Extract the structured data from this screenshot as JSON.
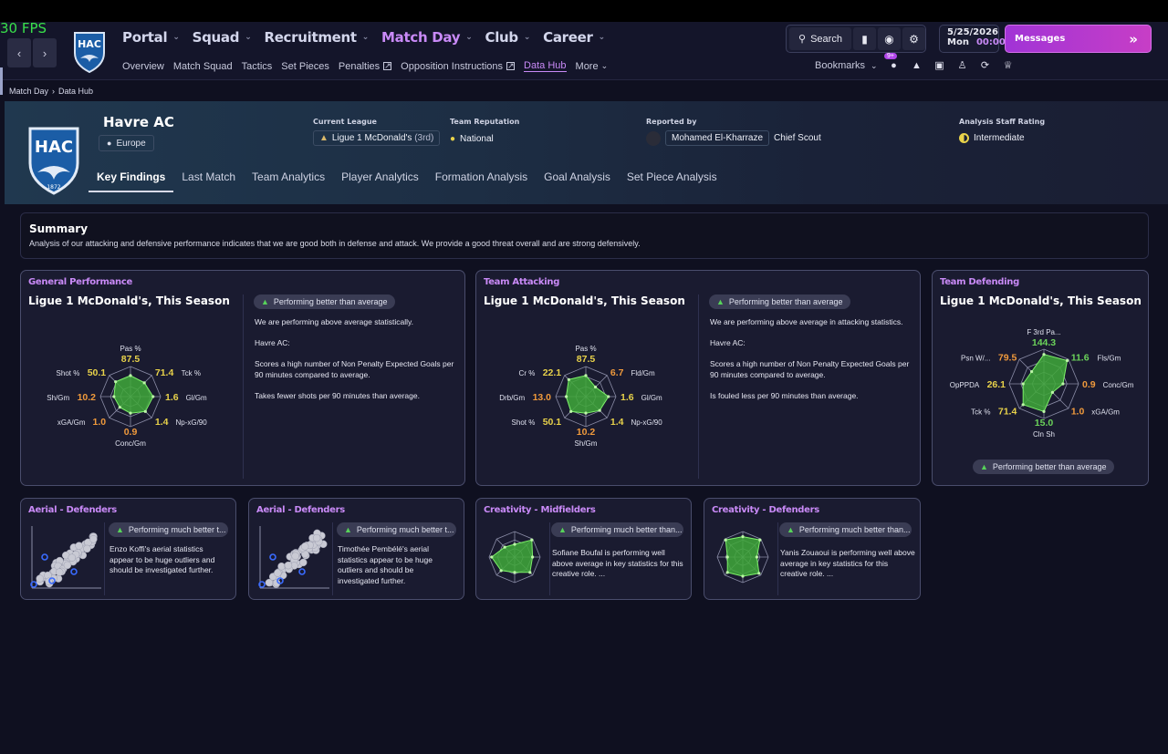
{
  "fps": "30 FPS",
  "nav": {
    "main": [
      {
        "label": "Portal",
        "active": false
      },
      {
        "label": "Squad",
        "active": false
      },
      {
        "label": "Recruitment",
        "active": false
      },
      {
        "label": "Match Day",
        "active": true
      },
      {
        "label": "Club",
        "active": false
      },
      {
        "label": "Career",
        "active": false
      }
    ],
    "sub": [
      {
        "label": "Overview",
        "active": false,
        "external": false
      },
      {
        "label": "Match Squad",
        "active": false,
        "external": false
      },
      {
        "label": "Tactics",
        "active": false,
        "external": false
      },
      {
        "label": "Set Pieces",
        "active": false,
        "external": false
      },
      {
        "label": "Penalties",
        "active": false,
        "external": true
      },
      {
        "label": "Opposition Instructions",
        "active": false,
        "external": true
      },
      {
        "label": "Data Hub",
        "active": true,
        "external": false
      },
      {
        "label": "More",
        "active": false,
        "external": false
      }
    ],
    "search_label": "Search",
    "date": "5/25/2026",
    "day": "Mon",
    "time": "00:00",
    "messages_label": "Messages",
    "bookmarks_label": "Bookmarks",
    "notif_badge": "9+"
  },
  "breadcrumb": [
    "Match Day",
    "Data Hub"
  ],
  "club": {
    "name": "Havre AC",
    "badge_text": "HAC",
    "badge_year": "1872",
    "region": "Europe",
    "current_league_label": "Current League",
    "current_league": "Ligue 1 McDonald's",
    "league_position": "(3rd)",
    "reputation_label": "Team Reputation",
    "reputation": "National",
    "reported_by_label": "Reported by",
    "reporter": "Mohamed El-Kharraze",
    "reporter_role": "Chief Scout",
    "rating_label": "Analysis Staff Rating",
    "rating": "Intermediate"
  },
  "tabs": [
    "Key Findings",
    "Last Match",
    "Team Analytics",
    "Player Analytics",
    "Formation Analysis",
    "Goal Analysis",
    "Set Piece Analysis"
  ],
  "summary": {
    "title": "Summary",
    "body": "Analysis of our attacking and defensive performance indicates that we are good both in defense and attack. We provide a good threat overall and are strong defensively."
  },
  "panels": [
    {
      "title": "General Performance",
      "subtitle": "Ligue 1 McDonald's, This Season",
      "pill": "Performing better than average",
      "text": [
        "We are performing above average statistically.",
        "Havre AC:",
        "Scores a high number of Non Penalty Expected Goals per 90 minutes compared to average.",
        "Takes fewer shots per 90 minutes than average."
      ],
      "radar": [
        {
          "label": "Pas %",
          "value": "87.5",
          "color": "#e8d24a"
        },
        {
          "label": "Tck %",
          "value": "71.4",
          "color": "#e8d24a"
        },
        {
          "label": "Gl/Gm",
          "value": "1.6",
          "color": "#e8d24a"
        },
        {
          "label": "Np-xG/90",
          "value": "1.4",
          "color": "#e8d24a"
        },
        {
          "label": "Conc/Gm",
          "value": "0.9",
          "color": "#f09a3c"
        },
        {
          "label": "xGA/Gm",
          "value": "1.0",
          "color": "#f09a3c"
        },
        {
          "label": "Sh/Gm",
          "value": "10.2",
          "color": "#f09a3c"
        },
        {
          "label": "Shot %",
          "value": "50.1",
          "color": "#e8d24a"
        }
      ]
    },
    {
      "title": "Team Attacking",
      "subtitle": "Ligue 1 McDonald's, This Season",
      "pill": "Performing better than average",
      "text": [
        "We are performing above average in attacking statistics.",
        "Havre AC:",
        "Scores a high number of Non Penalty Expected Goals per 90 minutes compared to average.",
        "Is fouled less per 90 minutes than average."
      ],
      "radar": [
        {
          "label": "Pas %",
          "value": "87.5",
          "color": "#e8d24a"
        },
        {
          "label": "Fld/Gm",
          "value": "6.7",
          "color": "#f09a3c"
        },
        {
          "label": "Gl/Gm",
          "value": "1.6",
          "color": "#e8d24a"
        },
        {
          "label": "Np-xG/90",
          "value": "1.4",
          "color": "#e8d24a"
        },
        {
          "label": "Sh/Gm",
          "value": "10.2",
          "color": "#f09a3c"
        },
        {
          "label": "Shot %",
          "value": "50.1",
          "color": "#e8d24a"
        },
        {
          "label": "Drb/Gm",
          "value": "13.0",
          "color": "#f09a3c"
        },
        {
          "label": "Cr %",
          "value": "22.1",
          "color": "#e8d24a"
        }
      ]
    },
    {
      "title": "Team Defending",
      "subtitle": "Ligue 1 McDonald's, This Season",
      "pill": "Performing better than average",
      "radar": [
        {
          "label": "F 3rd Pa...",
          "value": "144.3",
          "color": "#6bd35a"
        },
        {
          "label": "Fls/Gm",
          "value": "11.6",
          "color": "#6bd35a"
        },
        {
          "label": "Conc/Gm",
          "value": "0.9",
          "color": "#f09a3c"
        },
        {
          "label": "xGA/Gm",
          "value": "1.0",
          "color": "#f09a3c"
        },
        {
          "label": "Cln Sh",
          "value": "15.0",
          "color": "#6bd35a"
        },
        {
          "label": "Tck %",
          "value": "71.4",
          "color": "#e8d24a"
        },
        {
          "label": "OpPPDA",
          "value": "26.1",
          "color": "#e8d24a"
        },
        {
          "label": "Psn W/...",
          "value": "79.5",
          "color": "#f09a3c"
        }
      ]
    }
  ],
  "mini_panels": [
    {
      "title": "Aerial - Defenders",
      "pill": "Performing much better t...",
      "text": "Enzo Koffi's aerial statistics appear to be huge outliers and should be investigated further."
    },
    {
      "title": "Aerial - Defenders",
      "pill": "Performing much better t...",
      "text": "Timothée Pembélé's aerial statistics appear to be huge outliers and should be investigated further."
    },
    {
      "title": "Creativity - Midfielders",
      "pill": "Performing much better than...",
      "text": "Sofiane Boufal is performing well above average in key statistics for this creative role. ..."
    },
    {
      "title": "Creativity - Defenders",
      "pill": "Performing much better than...",
      "text": "Yanis Zouaoui is performing well above average in key statistics for this creative role. ..."
    }
  ]
}
